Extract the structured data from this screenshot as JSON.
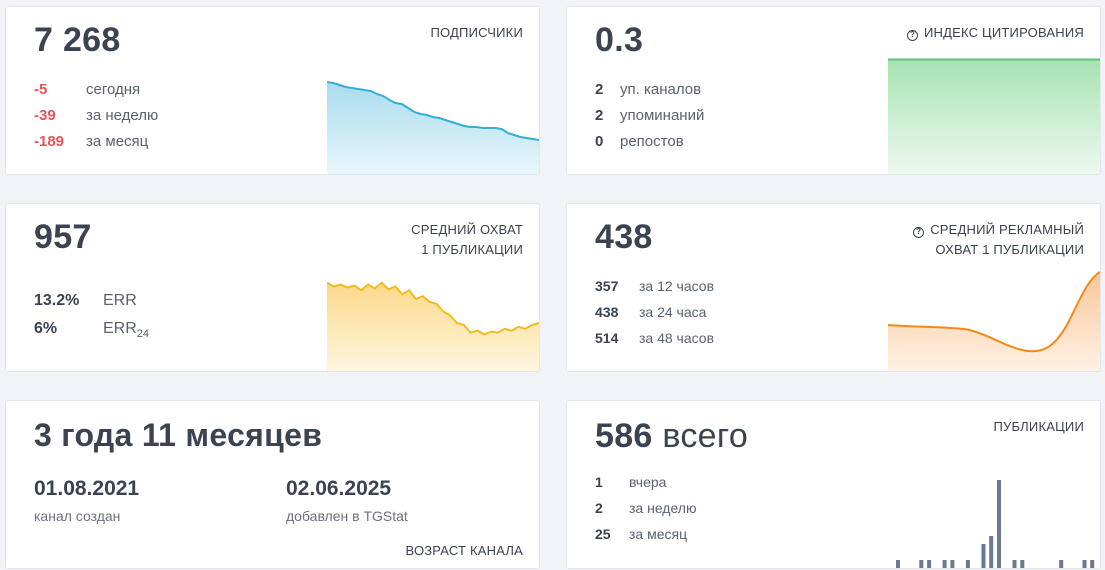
{
  "subscribers": {
    "title": "ПОДПИСЧИКИ",
    "value": "7 268",
    "changes": [
      {
        "value": "-5",
        "label": "сегодня"
      },
      {
        "value": "-39",
        "label": "за неделю"
      },
      {
        "value": "-189",
        "label": "за месяц"
      }
    ],
    "trend": [
      92,
      91,
      89,
      87,
      86,
      85,
      84,
      83,
      80,
      78,
      74,
      71,
      70,
      66,
      62,
      60,
      59,
      57,
      56,
      54,
      52,
      50,
      48,
      47,
      47,
      46,
      46,
      46,
      45,
      41,
      39,
      37,
      36,
      35,
      34
    ]
  },
  "citation": {
    "title": "ИНДЕКС ЦИТИРОВАНИЯ",
    "help_icon": "question-circle-icon",
    "value": "0.3",
    "rows": [
      {
        "value": "2",
        "label": "уп. каналов"
      },
      {
        "value": "2",
        "label": "упоминаний"
      },
      {
        "value": "0",
        "label": "репостов"
      }
    ],
    "fill_color": "#7ed491"
  },
  "reach": {
    "title_line1": "СРЕДНИЙ ОХВАТ",
    "title_line2": "1 ПУБЛИКАЦИИ",
    "value": "957",
    "err_value": "13.2%",
    "err_label": "ERR",
    "err24_value": "6%",
    "err24_label": "ERR",
    "err24_sub": "24",
    "trend": [
      92,
      88,
      90,
      87,
      89,
      84,
      90,
      86,
      92,
      85,
      88,
      80,
      84,
      75,
      78,
      72,
      70,
      62,
      58,
      50,
      48,
      40,
      42,
      38,
      41,
      40,
      44,
      42,
      46,
      44,
      48,
      50
    ]
  },
  "ad_reach": {
    "title_line1": "СРЕДНИЙ РЕКЛАМНЫЙ",
    "title_line2": "ОХВАТ 1 ПУБЛИКАЦИИ",
    "help_icon": "question-circle-icon",
    "value": "438",
    "rows": [
      {
        "value": "357",
        "label": "за 12 часов"
      },
      {
        "value": "438",
        "label": "за 24 часа"
      },
      {
        "value": "514",
        "label": "за 48 часов"
      }
    ]
  },
  "age": {
    "value": "3 года 11 месяцев",
    "created_date": "01.08.2021",
    "created_label": "канал создан",
    "added_date": "02.06.2025",
    "added_label": "добавлен в TGStat",
    "title": "ВОЗРАСТ КАНАЛА"
  },
  "publications": {
    "title": "ПУБЛИКАЦИИ",
    "value": "586",
    "value_suffix": "всего",
    "rows": [
      {
        "value": "1",
        "label": "вчера"
      },
      {
        "value": "2",
        "label": "за неделю"
      },
      {
        "value": "25",
        "label": "за месяц"
      }
    ],
    "bars": [
      1,
      0,
      0,
      1,
      1,
      0,
      1,
      1,
      0,
      1,
      0,
      3,
      4,
      11,
      0,
      1,
      1,
      0,
      0,
      0,
      0,
      1,
      0,
      0,
      1,
      1
    ]
  },
  "colors": {
    "subs_line": "#34aed4",
    "reach_line": "#f2bb1d",
    "ad_line": "#f28a19",
    "bar": "#6b7a90",
    "negative": "#e5555a"
  }
}
